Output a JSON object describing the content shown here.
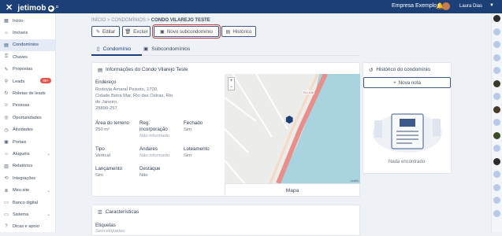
{
  "topbar": {
    "close": "✕",
    "brand": "jetimob",
    "search_icon": "⌕",
    "company": "Empresa Exemplo",
    "user": "Laura Dias"
  },
  "sidebar": {
    "items": [
      {
        "label": "Início",
        "icon": "▦"
      },
      {
        "label": "Imóveis",
        "icon": "⌂"
      },
      {
        "label": "Condomínios",
        "icon": "▤",
        "active": true
      },
      {
        "label": "Chaves",
        "icon": "⚿"
      },
      {
        "label": "Propostas",
        "icon": "✎"
      },
      {
        "label": "Leads",
        "icon": "⚲",
        "badge": "99+"
      },
      {
        "label": "Roletas de leads",
        "icon": "↻"
      },
      {
        "label": "Pessoas",
        "icon": "☺"
      },
      {
        "label": "Oportunidades",
        "icon": "◎"
      },
      {
        "label": "Atividades",
        "icon": "◷"
      },
      {
        "label": "Portais",
        "icon": "▣"
      },
      {
        "label": "Aluguéis",
        "icon": "⌂",
        "chev": "⌄"
      },
      {
        "label": "Relatórios",
        "icon": "▥"
      },
      {
        "label": "Integrações",
        "icon": "⟲"
      },
      {
        "label": "Meu site",
        "icon": "⊕",
        "chev": "⌄"
      },
      {
        "label": "Banco digital",
        "icon": "▭"
      },
      {
        "label": "Sistema",
        "icon": "▭",
        "chev": "⌄"
      },
      {
        "label": "Dicas e apoio",
        "icon": "?"
      }
    ]
  },
  "breadcrumb": {
    "a": "INÍCIO",
    "b": "CONDOMÍNIOS",
    "c": "CONDO VILAREJO TESTE",
    "sep": ">"
  },
  "toolbar": {
    "edit": "Editar",
    "delete": "Excluir",
    "new_sub": "Novo subcondomínio",
    "history": "Histórico"
  },
  "tabs": {
    "condominio": "Condomínio",
    "sub": "Subcondomínios"
  },
  "info": {
    "title": "Informações do Condo Vilarejo Teste",
    "endereco_label": "Endereço",
    "endereco_lines": [
      "Rodovia Amaral Peixoto, 1700,",
      "Cidade Beira Mar, Rio das Ostras, Rio",
      "de Janeiro,",
      "28890-257"
    ],
    "area_label": "Área do terreno",
    "area": "250 m²",
    "reg_label1": "Reg.",
    "reg_label2": "incorporação",
    "reg": "Não informado",
    "fechado_label": "Fechado",
    "fechado": "Sim",
    "tipo_label": "Tipo",
    "tipo": "Vertical",
    "andares_label": "Andares",
    "andares": "Não informado",
    "lote_label": "Loteamento",
    "lote": "Sim",
    "lanc_label": "Lançamento",
    "lanc": "Sim",
    "dest_label": "Destaque",
    "dest": "Não",
    "map_label": "Mapa",
    "road": "RJ-106",
    "zoom_in": "+",
    "zoom_out": "−",
    "attribution": "Leaflet"
  },
  "history": {
    "title": "Histórico do condomínio",
    "new_note": "Nova nota",
    "empty": "Nada encontrado"
  },
  "features": {
    "title": "Características",
    "etiquetas": "Etiquetas",
    "sem": "Sem etiquetas"
  },
  "colors": {
    "primary": "#1d3f78",
    "highlight": "#d63a3a",
    "road": "#e98f8a",
    "sea": "#a9d3df"
  }
}
